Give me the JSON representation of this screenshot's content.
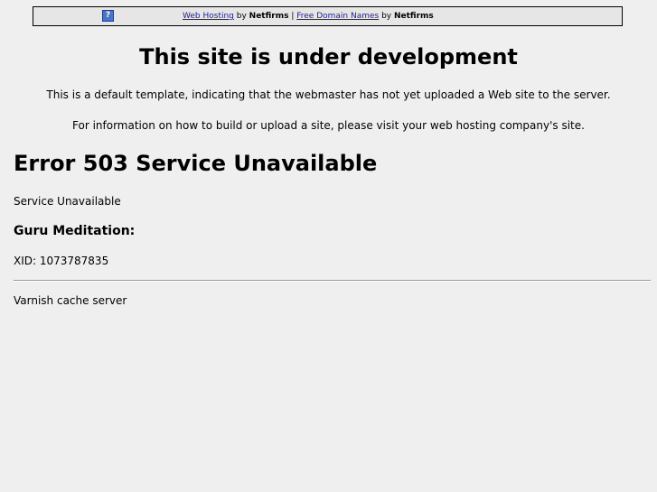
{
  "banner": {
    "icon": "question-icon",
    "icon_glyph": "?",
    "link1": "Web Hosting",
    "by1": " by ",
    "brand1": "Netfirms",
    "separator": " | ",
    "link2": "Free Domain Names",
    "by2": " by ",
    "brand2": "Netfirms"
  },
  "main": {
    "title": "This site is under development",
    "line1": "This is a default template, indicating that the webmaster has not yet uploaded a Web site to the server.",
    "line2": "For information on how to build or upload a site, please visit your web hosting company's site."
  },
  "error": {
    "title": "Error 503 Service Unavailable",
    "message": "Service Unavailable",
    "guru_heading": "Guru Meditation:",
    "xid": "XID: 1073787835",
    "footer": "Varnish cache server"
  }
}
